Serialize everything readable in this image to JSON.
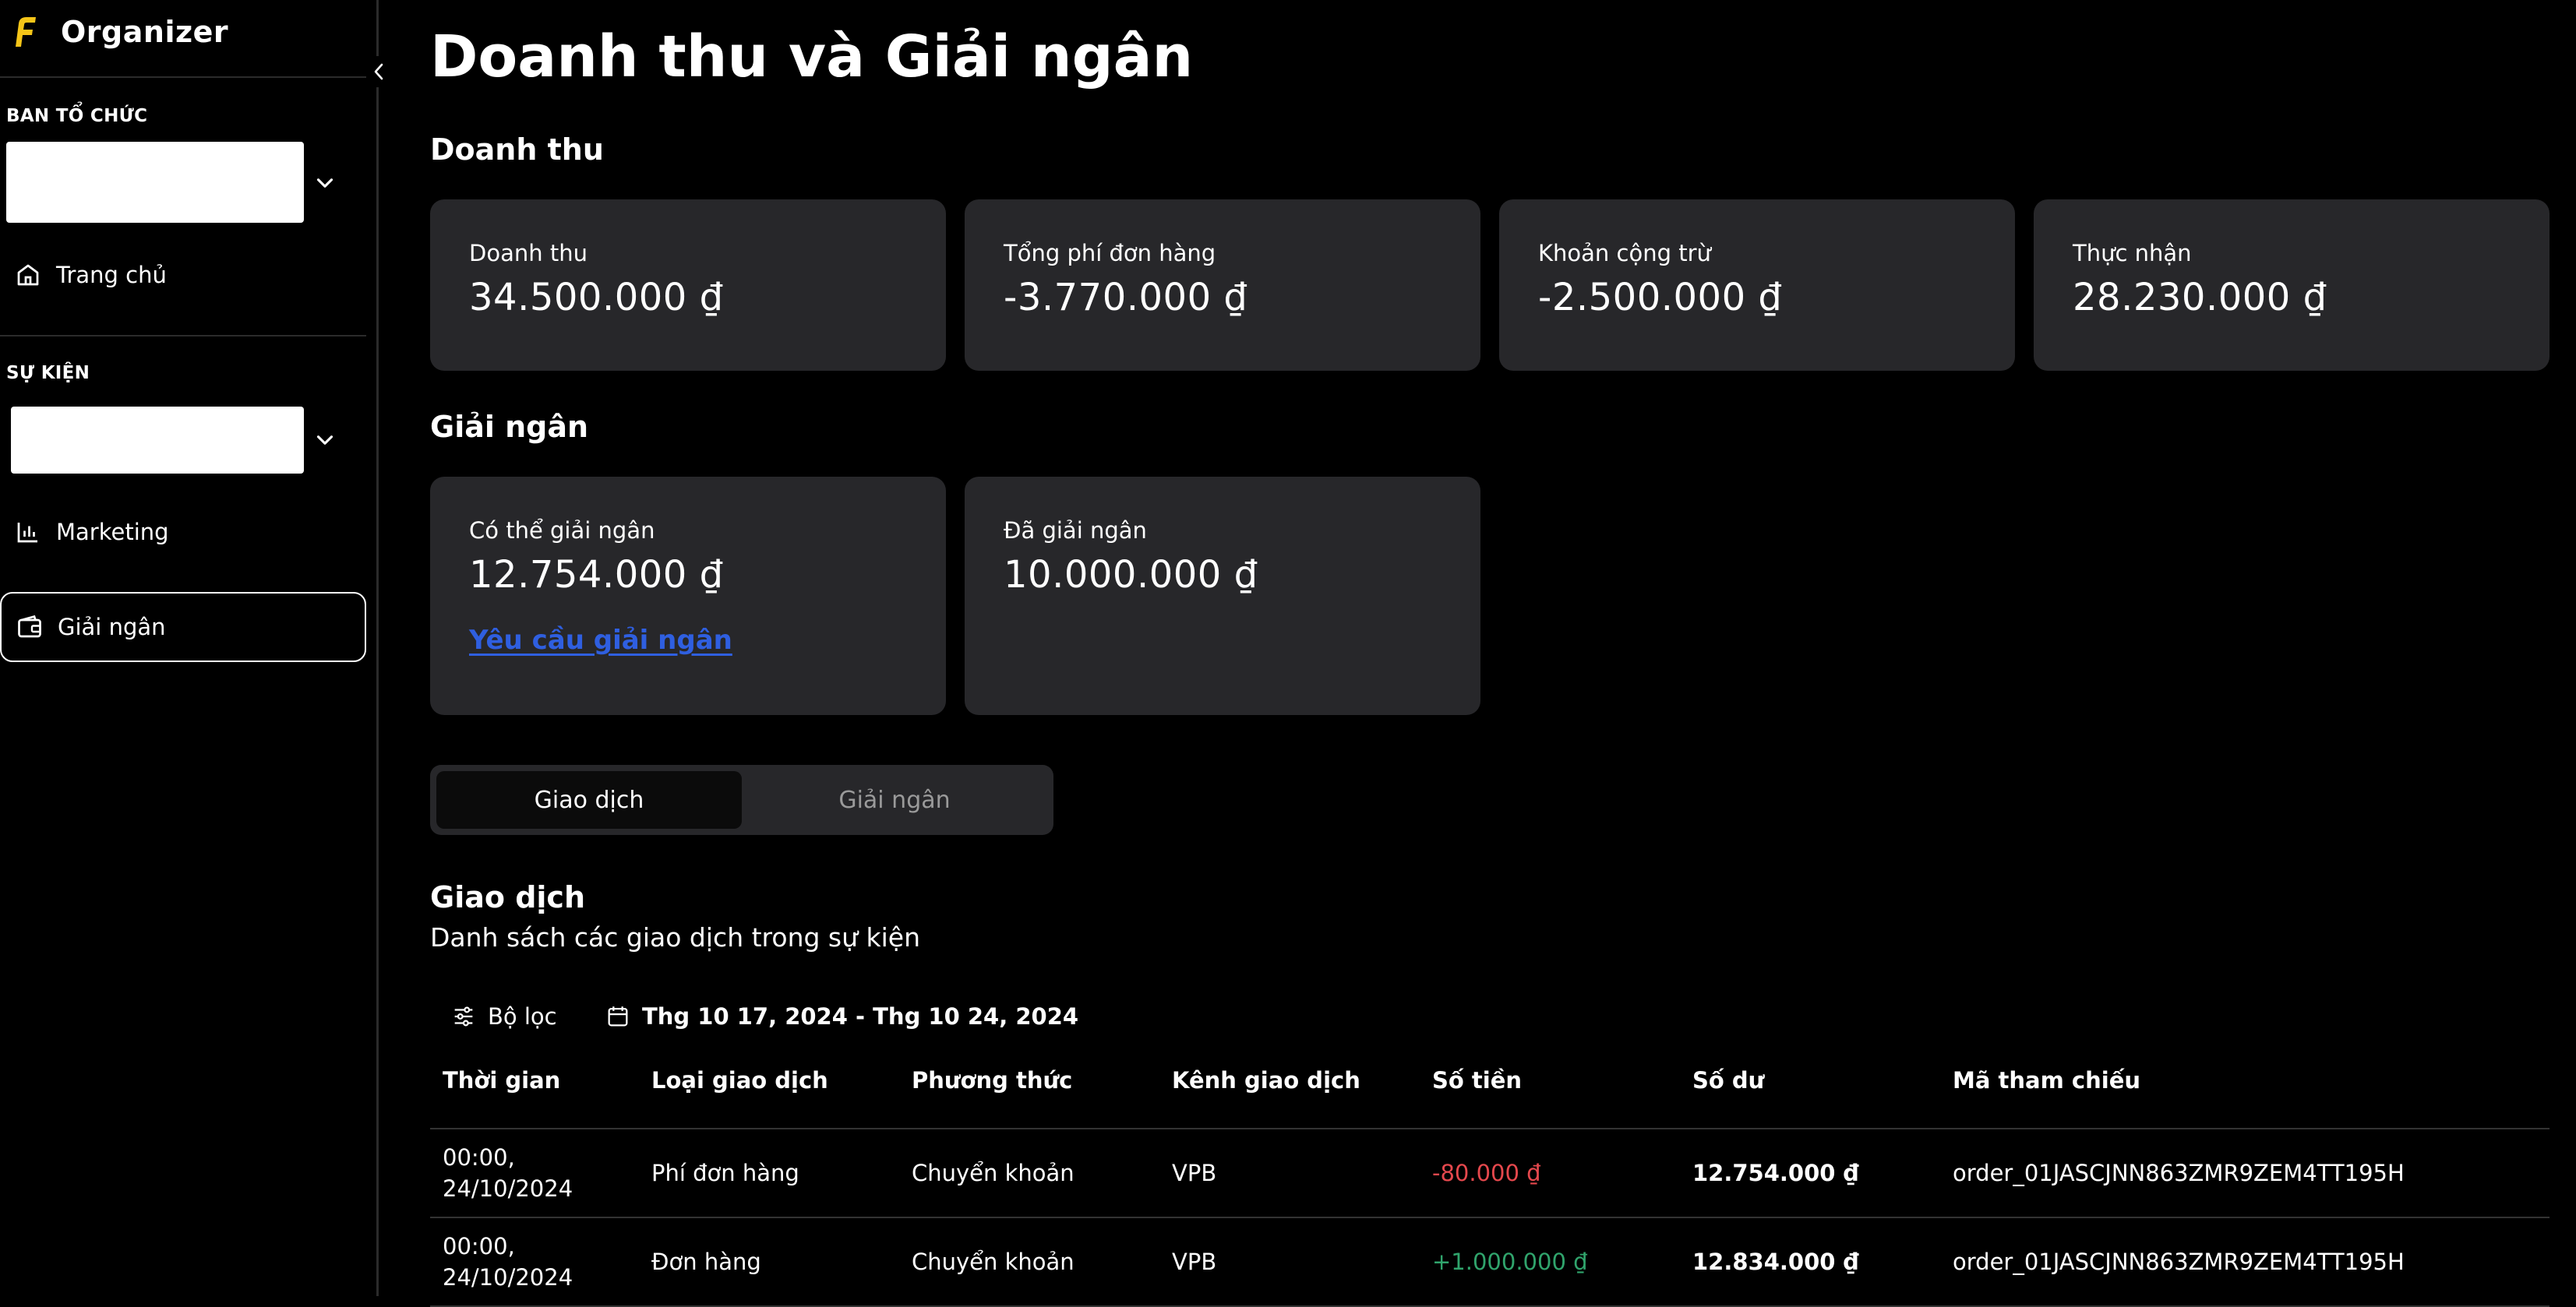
{
  "sidebar": {
    "brand": "Organizer",
    "org_label": "BAN TỔ CHỨC",
    "org_select_value": "",
    "home_label": "Trang chủ",
    "event_label": "SỰ KIỆN",
    "event_select_value": "",
    "marketing_label": "Marketing",
    "payout_label": "Giải ngân"
  },
  "page": {
    "title": "Doanh thu và Giải ngân",
    "revenue_heading": "Doanh thu",
    "revenue_cards": [
      {
        "label": "Doanh thu",
        "value": "34.500.000 ₫"
      },
      {
        "label": "Tổng phí đơn hàng",
        "value": "-3.770.000 ₫"
      },
      {
        "label": "Khoản cộng trừ",
        "value": "-2.500.000 ₫"
      },
      {
        "label": "Thực nhận",
        "value": "28.230.000 ₫"
      }
    ],
    "payout_heading": "Giải ngân",
    "payout_cards": [
      {
        "label": "Có thể giải ngân",
        "value": "12.754.000 ₫",
        "link": "Yêu cầu giải ngân"
      },
      {
        "label": "Đã giải ngân",
        "value": "10.000.000 ₫"
      }
    ],
    "tabs": [
      {
        "label": "Giao dịch",
        "active": true
      },
      {
        "label": "Giải ngân",
        "active": false
      }
    ],
    "transactions": {
      "title": "Giao dịch",
      "description": "Danh sách các giao dịch trong sự kiện",
      "filter_label": "Bộ lọc",
      "date_range": "Thg 10 17, 2024 - Thg 10 24, 2024",
      "columns": [
        "Thời gian",
        "Loại giao dịch",
        "Phương thức",
        "Kênh giao dịch",
        "Số tiền",
        "Số dư",
        "Mã tham chiếu"
      ],
      "rows": [
        {
          "time": "00:00, 24/10/2024",
          "type": "Phí đơn hàng",
          "method": "Chuyển khoản",
          "channel": "VPB",
          "amount": "-80.000 ₫",
          "balance": "12.754.000 ₫",
          "ref": "order_01JASCJNN863ZMR9ZEM4TT195H"
        },
        {
          "time": "00:00, 24/10/2024",
          "type": "Đơn hàng",
          "method": "Chuyển khoản",
          "channel": "VPB",
          "amount": "+1.000.000 ₫",
          "balance": "12.834.000 ₫",
          "ref": "order_01JASCJNN863ZMR9ZEM4TT195H"
        }
      ]
    }
  },
  "colors": {
    "background": "#000000",
    "card": "#27272a",
    "accent_yellow": "#f5c518",
    "link_blue": "#2f5fe0",
    "negative": "#e5484d",
    "positive": "#30a46c"
  },
  "icons": [
    "logo-icon",
    "chevron-left-icon",
    "chevron-down-icon",
    "home-icon",
    "bar-chart-icon",
    "wallet-icon",
    "filter-icon",
    "calendar-icon"
  ]
}
